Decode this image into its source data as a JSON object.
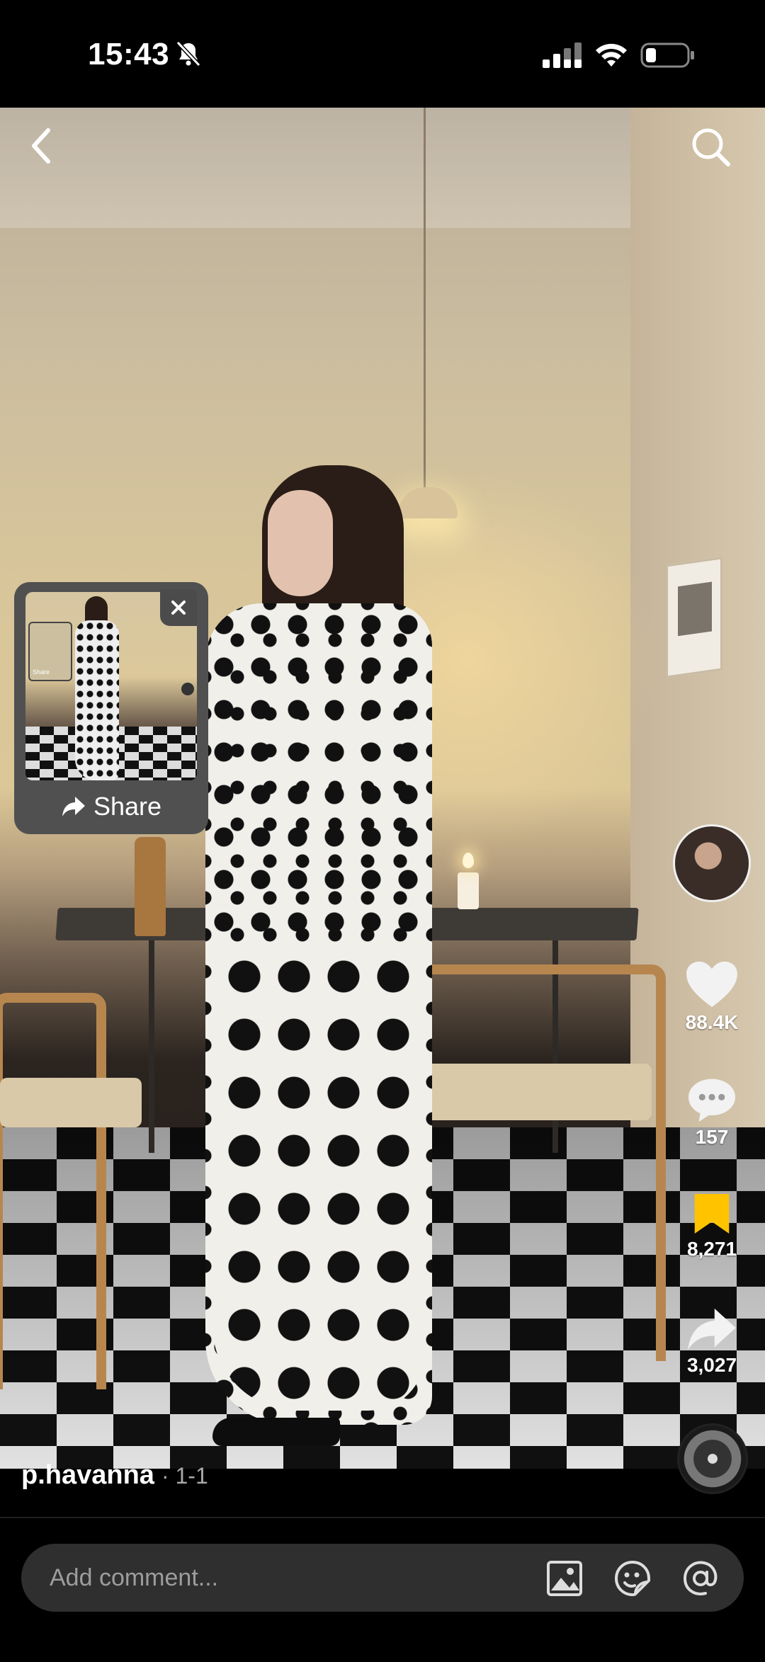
{
  "status_bar": {
    "time": "15:43",
    "icons": [
      "bell-slash-icon",
      "cellular-signal-icon",
      "wifi-icon",
      "battery-icon"
    ]
  },
  "video": {
    "back_icon": "chevron-left-icon",
    "search_icon": "search-icon"
  },
  "share_popup": {
    "label": "Share",
    "close_icon": "close-icon",
    "share_icon": "share-arrow-icon"
  },
  "actions": {
    "like_count": "88.4K",
    "comment_count": "157",
    "save_count": "8,271",
    "share_count": "3,027",
    "save_color": "#FFC300"
  },
  "post": {
    "author": "p.havanna",
    "meta": "· 1-1"
  },
  "comment_bar": {
    "placeholder": "Add comment..."
  }
}
